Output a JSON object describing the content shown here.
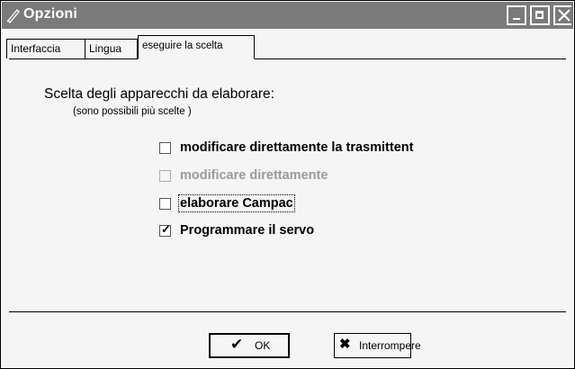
{
  "window": {
    "title": "Opzioni",
    "icon": "pen-icon"
  },
  "tabs": [
    {
      "label": "Interfaccia",
      "active": false
    },
    {
      "label": "Lingua",
      "active": false
    },
    {
      "label": "eseguire la scelta",
      "active": true
    }
  ],
  "section": {
    "title": "Scelta degli apparecchi da elaborare:",
    "subtitle": "(sono possibili più scelte )"
  },
  "options": [
    {
      "label": "modificare direttamente la trasmittent",
      "checked": false,
      "enabled": true
    },
    {
      "label": "modificare direttamente",
      "checked": false,
      "enabled": false
    },
    {
      "label": "elaborare Campac",
      "checked": false,
      "enabled": true,
      "focused": true
    },
    {
      "label": "Programmare il servo",
      "checked": true,
      "enabled": true
    }
  ],
  "buttons": {
    "ok_label": "OK",
    "ok_icon": "check-icon",
    "cancel_label": "Interrompere",
    "cancel_icon": "x-icon"
  },
  "colors": {
    "titlebar": "#7a7a7a",
    "disabled_text": "#9a9a9a"
  }
}
